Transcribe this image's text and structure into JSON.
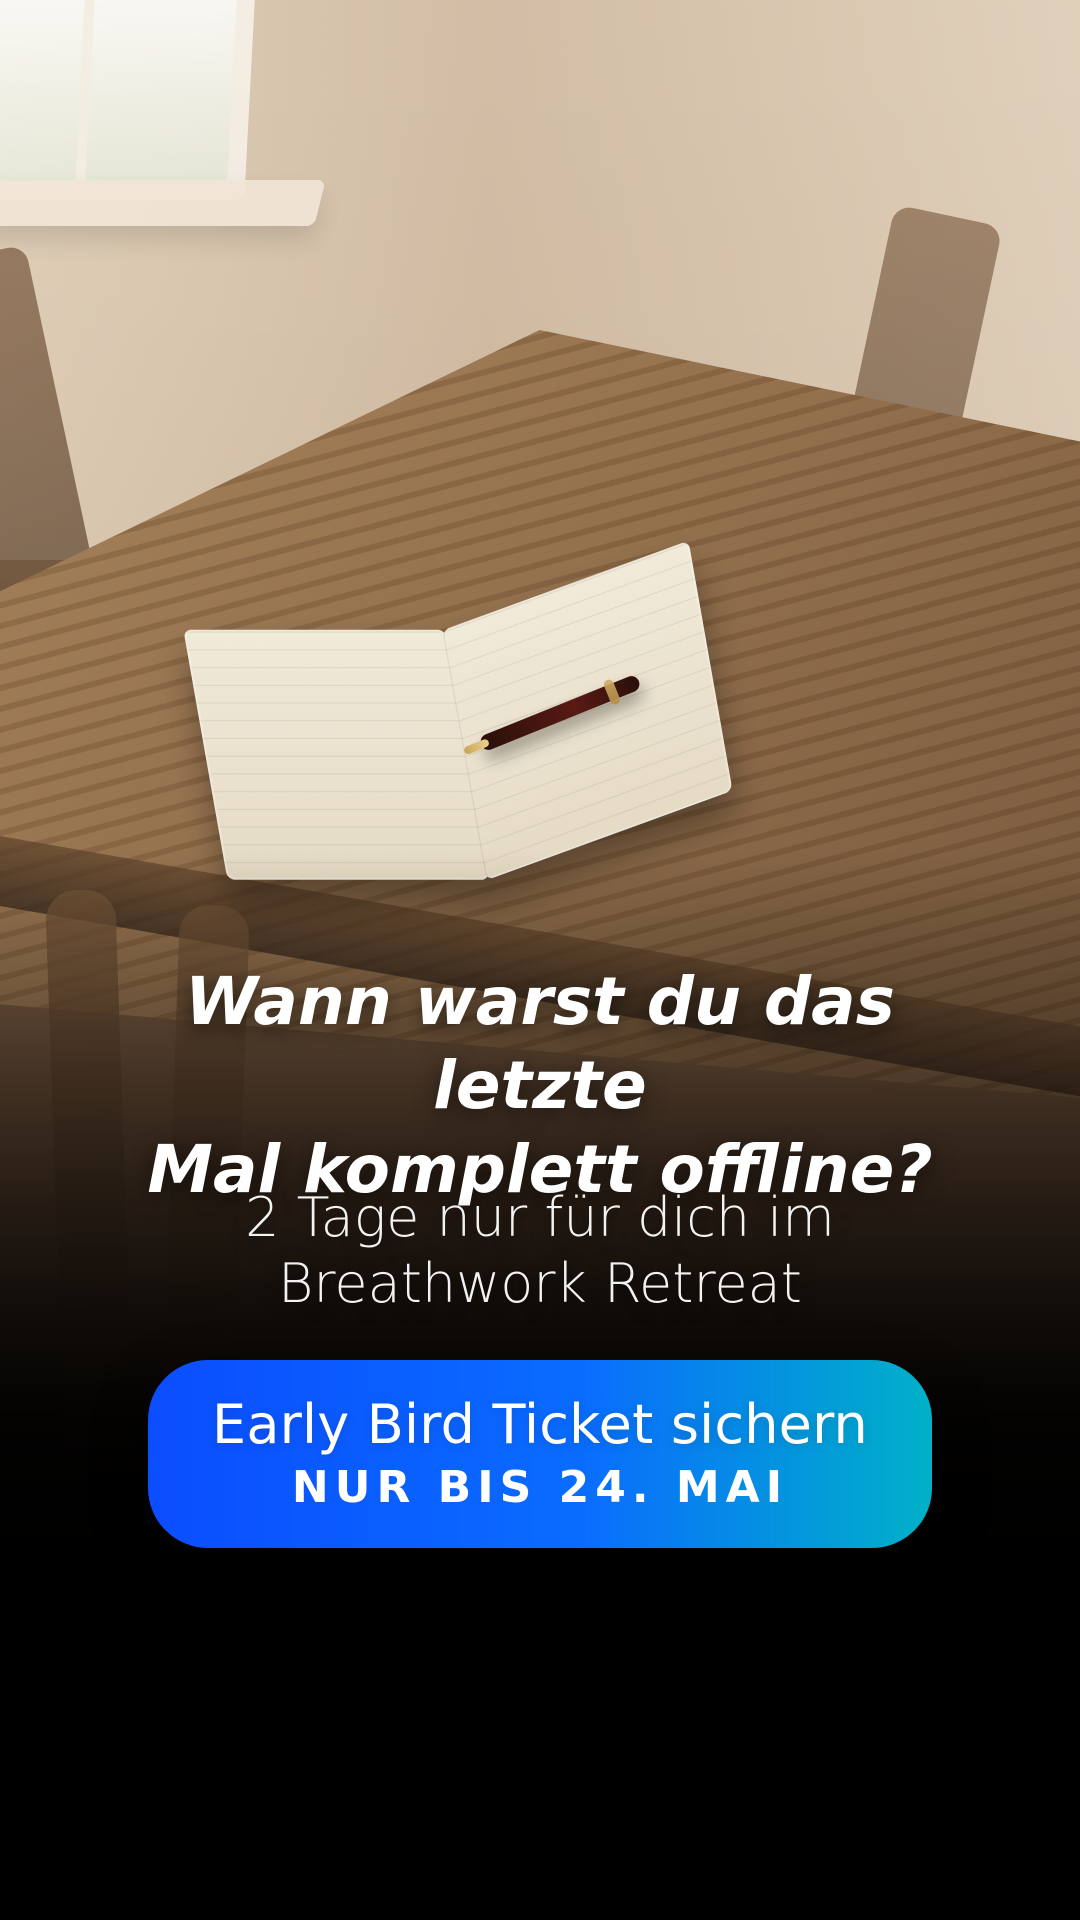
{
  "ad": {
    "headline": {
      "line1": "Wann warst du das letzte",
      "line2": "Mal komplett offline?"
    },
    "subline": {
      "line1": "2 Tage nur für dich im",
      "line2": "Breathwork Retreat"
    },
    "cta": {
      "line1": "Early Bird Ticket sichern",
      "line2": "NUR BIS 24. MAI"
    }
  }
}
